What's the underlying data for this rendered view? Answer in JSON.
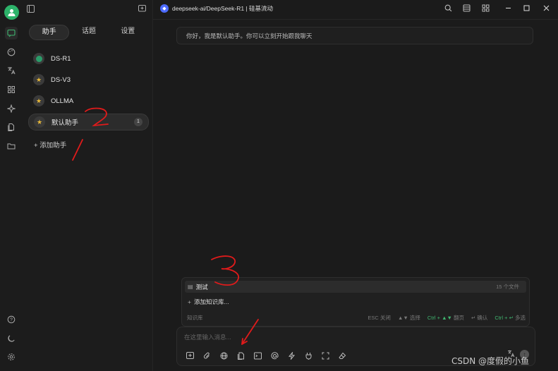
{
  "rail": {
    "icons": [
      "avatar",
      "chat-icon",
      "palette-icon",
      "translate-icon",
      "apps-icon",
      "sparkle-icon",
      "files-icon",
      "folder-icon",
      "help-icon",
      "moon-icon",
      "settings-icon"
    ]
  },
  "sidebar": {
    "tabs": [
      {
        "label": "助手",
        "active": true
      },
      {
        "label": "话题",
        "active": false
      },
      {
        "label": "设置",
        "active": false
      }
    ],
    "assistants": [
      {
        "name": "DS-R1",
        "active": false
      },
      {
        "name": "DS-V3",
        "active": false
      },
      {
        "name": "OLLMA",
        "active": false
      },
      {
        "name": "默认助手",
        "active": true,
        "count": "1"
      }
    ],
    "add_label": "添加助手"
  },
  "header": {
    "model_label": "deepseek-ai/DeepSeek-R1 | 硅基流动"
  },
  "chat": {
    "greeting": "你好，我是默认助手。你可以立刻开始跟我聊天"
  },
  "knowledge": {
    "items": [
      {
        "name": "测试",
        "meta": "15 个文件"
      }
    ],
    "add_label": "添加知识库...",
    "footer_label": "知识库",
    "hints": {
      "esc": "ESC 关闭",
      "select": "▲▼ 选择",
      "page_key": "Ctrl + ▲▼",
      "page_text": "翻页",
      "confirm": "↵ 确认",
      "multi_key": "Ctrl + ↵",
      "multi_text": "多选"
    }
  },
  "input": {
    "placeholder": "在这里输入消息...",
    "tools": [
      "new-topic-icon",
      "attach-icon",
      "web-search-icon",
      "knowledge-icon",
      "terminal-icon",
      "mention-icon",
      "quick-phrase-icon",
      "mcp-icon",
      "fullscreen-icon",
      "clear-icon"
    ]
  },
  "watermark": "CSDN @度假的小鱼",
  "annotations": {
    "labels": [
      "1",
      "2",
      "3"
    ],
    "color": "#e01b1b"
  },
  "colors": {
    "accent": "#3fb56f",
    "background": "#1b1b1b",
    "star": "#e8b93a",
    "model_logo": "#4d6bfe"
  }
}
